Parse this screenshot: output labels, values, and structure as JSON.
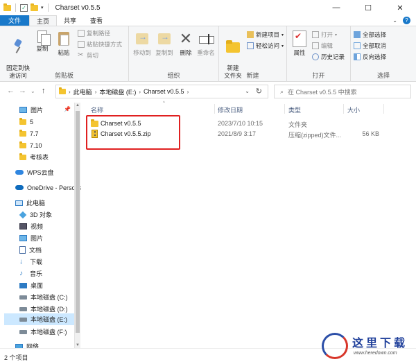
{
  "window": {
    "title": "Charset v0.5.5",
    "minimize_glyph": "—",
    "maximize_glyph": "☐",
    "close_glyph": "✕",
    "qat_dropdown_glyph": "▾"
  },
  "tabs": [
    {
      "label": "文件"
    },
    {
      "label": "主页"
    },
    {
      "label": "共享"
    },
    {
      "label": "查看"
    }
  ],
  "ribbon": {
    "clipboard": {
      "label": "剪贴板",
      "pin_quick_access": "固定到快\n速访问",
      "copy": "复制",
      "paste": "粘贴",
      "copy_path": "复制路径",
      "paste_shortcut": "粘贴快捷方式",
      "cut": "剪切"
    },
    "organize": {
      "label": "组织",
      "move_to": "移动到",
      "copy_to": "复制到",
      "delete": "删除",
      "rename": "重命名"
    },
    "new": {
      "label": "新建",
      "new_folder": "新建\n文件夹",
      "new_item": "新建项目",
      "easy_access": "轻松访问"
    },
    "open": {
      "label": "打开",
      "properties": "属性",
      "open": "打开",
      "edit": "编辑",
      "history": "历史记录"
    },
    "select": {
      "label": "选择",
      "select_all": "全部选择",
      "select_none": "全部取消",
      "invert": "反向选择"
    }
  },
  "address": {
    "breadcrumbs": [
      "此电脑",
      "本地磁盘 (E:)",
      "Charset v0.5.5"
    ],
    "search_placeholder": "在 Charset v0.5.5 中搜索",
    "back_glyph": "←",
    "forward_glyph": "→",
    "history_glyph": "⌄",
    "up_glyph": "↑",
    "refresh_glyph": "↻",
    "search_glyph": "⌕"
  },
  "nav_pane": {
    "items": [
      {
        "label": "图片",
        "icon": "pictures-icon"
      },
      {
        "label": "5",
        "icon": "folder-icon"
      },
      {
        "label": "7.7",
        "icon": "folder-icon"
      },
      {
        "label": "7.10",
        "icon": "folder-icon"
      },
      {
        "label": "考核表",
        "icon": "folder-icon"
      },
      {
        "label": "WPS云盘",
        "icon": "wps-cloud-icon"
      },
      {
        "label": "OneDrive - Personal",
        "icon": "onedrive-icon"
      },
      {
        "label": "此电脑",
        "icon": "this-pc-icon"
      },
      {
        "label": "3D 对象",
        "icon": "3d-objects-icon"
      },
      {
        "label": "视频",
        "icon": "videos-icon"
      },
      {
        "label": "图片",
        "icon": "pictures-icon"
      },
      {
        "label": "文档",
        "icon": "documents-icon"
      },
      {
        "label": "下载",
        "icon": "downloads-icon"
      },
      {
        "label": "音乐",
        "icon": "music-icon"
      },
      {
        "label": "桌面",
        "icon": "desktop-icon"
      },
      {
        "label": "本地磁盘 (C:)",
        "icon": "drive-icon"
      },
      {
        "label": "本地磁盘 (D:)",
        "icon": "drive-icon"
      },
      {
        "label": "本地磁盘 (E:)",
        "icon": "drive-icon"
      },
      {
        "label": "本地磁盘 (F:)",
        "icon": "drive-icon"
      },
      {
        "label": "网络",
        "icon": "network-icon"
      }
    ]
  },
  "columns": [
    "名称",
    "修改日期",
    "类型",
    "大小"
  ],
  "files": [
    {
      "name": "Charset v0.5.5",
      "modified": "2023/7/10 10:15",
      "type": "文件夹",
      "size": "",
      "icon": "folder-icon"
    },
    {
      "name": "Charset v0.5.5.zip",
      "modified": "2021/8/9 3:17",
      "type": "压缩(zipped)文件...",
      "size": "56 KB",
      "icon": "zip-file-icon"
    }
  ],
  "status": {
    "item_count": "2 个项目"
  },
  "watermark": {
    "title": "这里下载",
    "url": "www.heredown.com"
  },
  "colors": {
    "accent": "#1979ca",
    "highlight_box": "#e02020",
    "selection": "#cce8ff"
  }
}
